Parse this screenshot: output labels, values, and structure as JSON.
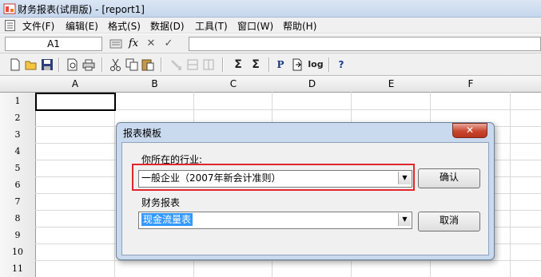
{
  "window": {
    "title": "财务报表(试用版) - [report1]"
  },
  "menu": {
    "items": [
      "文件(F)",
      "编辑(E)",
      "格式(S)",
      "数据(D)",
      "工具(T)",
      "窗口(W)",
      "帮助(H)"
    ]
  },
  "formula_bar": {
    "cell_ref": "A1",
    "fx_label": "fx",
    "cancel_symbol": "✕",
    "confirm_symbol": "✓",
    "formula_value": ""
  },
  "toolbar": {
    "buttons": [
      "new-icon",
      "open-icon",
      "save-icon",
      "print-preview-icon",
      "print-icon",
      "cut-icon",
      "copy-icon",
      "paste-icon",
      "format-painter-icon",
      "insert-row-icon",
      "insert-column-icon",
      "sum-icon",
      "sum-all-icon",
      "p-icon",
      "page-break-icon",
      "log-icon",
      "help-pointer-icon"
    ],
    "sum_label": "Σ",
    "sum_all_label": "Σ",
    "p_label": "P",
    "log_label": "log",
    "help_label": "?"
  },
  "grid": {
    "columns": [
      "A",
      "B",
      "C",
      "D",
      "E",
      "F"
    ],
    "rows": [
      "1",
      "2",
      "3",
      "4",
      "5",
      "6",
      "7",
      "8",
      "9",
      "10",
      "11"
    ]
  },
  "dialog": {
    "title": "报表模板",
    "close_label": "✕",
    "industry_label": "你所在的行业:",
    "industry_value": "一般企业（2007年新会计准则）",
    "report_label": "财务报表",
    "report_value": "现金流量表",
    "ok_label": "确认",
    "cancel_label": "取消"
  },
  "colors": {
    "highlight": "#e0262c",
    "selection": "#3399ff",
    "dialog_frame": "#c9d9ee"
  }
}
